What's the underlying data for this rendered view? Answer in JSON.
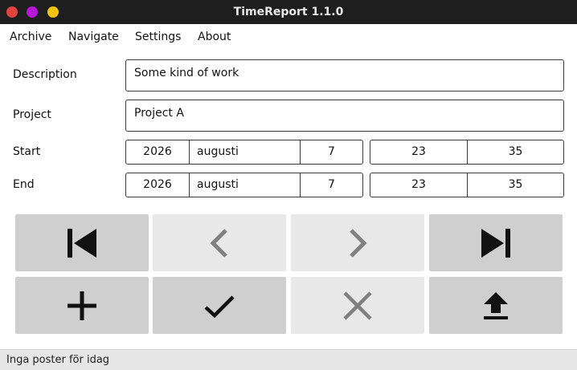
{
  "window": {
    "title": "TimeReport 1.1.0"
  },
  "menu": {
    "items": [
      "Archive",
      "Navigate",
      "Settings",
      "About"
    ]
  },
  "form": {
    "description_label": "Description",
    "description_value": "Some kind of work",
    "project_label": "Project",
    "project_value": "Project A",
    "start_label": "Start",
    "end_label": "End",
    "start": {
      "year": "2026",
      "month": "augusti",
      "day": "7",
      "hour": "23",
      "minute": "35"
    },
    "end": {
      "year": "2026",
      "month": "augusti",
      "day": "7",
      "hour": "23",
      "minute": "35"
    }
  },
  "buttons": [
    {
      "icon": "skip-first-icon",
      "enabled": true
    },
    {
      "icon": "chevron-left-icon",
      "enabled": false
    },
    {
      "icon": "chevron-right-icon",
      "enabled": false
    },
    {
      "icon": "skip-last-icon",
      "enabled": true
    },
    {
      "icon": "plus-icon",
      "enabled": true
    },
    {
      "icon": "checkmark-icon",
      "enabled": true
    },
    {
      "icon": "close-icon",
      "enabled": false
    },
    {
      "icon": "upload-icon",
      "enabled": true
    }
  ],
  "colors": {
    "titlebar": "#1e1e1e",
    "button_enabled": "#cfcfcf",
    "button_disabled": "#e8e8e8",
    "icon_enabled": "#111111",
    "icon_disabled": "#808080"
  },
  "status": {
    "text": "Inga poster för idag"
  }
}
